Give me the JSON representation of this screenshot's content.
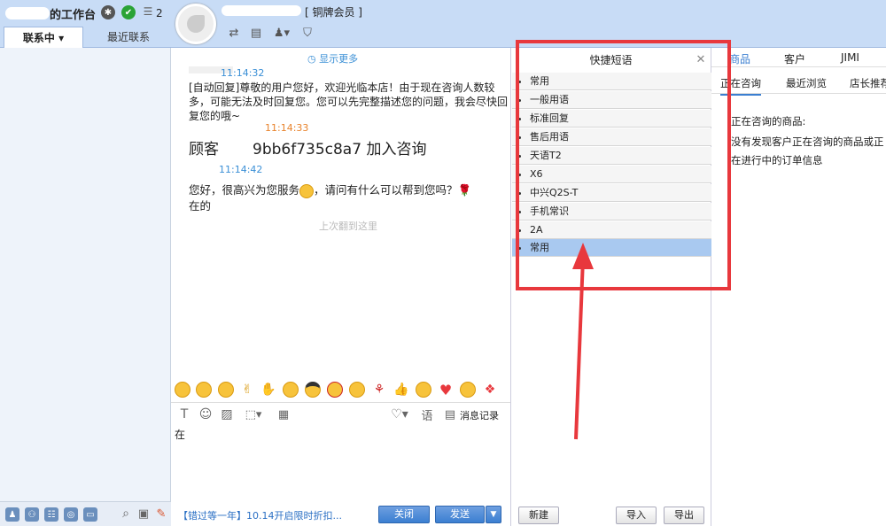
{
  "header": {
    "workbench_title": "的工作台",
    "unread_count": "2",
    "member_tag": "[ 铜牌会员 ]",
    "tabs": [
      "联系中",
      "最近联系"
    ]
  },
  "chat": {
    "show_more": "显示更多",
    "messages": [
      {
        "time": "11:14:32",
        "text": "[自动回复]尊敬的用户您好，欢迎光临本店！由于现在咨询人数较多，可能无法及时回复您。您可以先完整描述您的问题，我会尽快回复您的哦~"
      },
      {
        "time": "11:14:33",
        "label": "顾客",
        "customer_id": "9bb6f735c8a7",
        "action": "加入咨询"
      },
      {
        "time": "11:14:42",
        "text": "您好，很高兴为您服务",
        "text2": "，请问有什么可以帮到您吗？",
        "text3": "在的"
      }
    ],
    "last_read": "上次翻到这里",
    "input_value": "在",
    "history_label": "消息记录",
    "promo": "【错过等一年】10.14开启限时折扣...",
    "close_label": "关闭",
    "send_label": "发送"
  },
  "quick_phrases": {
    "title": "快捷短语",
    "items": [
      "常用",
      "一般用语",
      "标准回复",
      "售后用语",
      "天语T2",
      "X6",
      "中兴Q2S-T",
      "手机常识",
      "2A",
      "常用"
    ],
    "selected_index": 9,
    "new_label": "新建",
    "import_label": "导入",
    "export_label": "导出"
  },
  "right_panel": {
    "tabs": [
      "商品",
      "客户",
      "JIMI"
    ],
    "subtabs": [
      "正在咨询",
      "最近浏览",
      "店长推荐"
    ],
    "heading": "正在咨询的商品:",
    "empty_text": "没有发现客户正在咨询的商品或正在进行中的订单信息"
  },
  "colors": {
    "accent": "#3b7fd1",
    "highlight_box": "#e8383d",
    "selected_row": "#a9c9f0",
    "time_blue": "#3a8fd6",
    "time_orange": "#e8832c"
  }
}
